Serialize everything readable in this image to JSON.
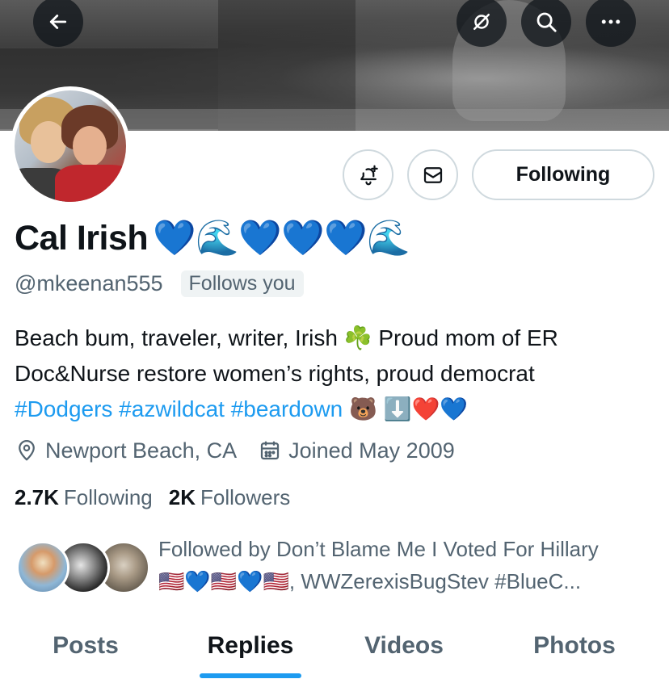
{
  "profile": {
    "display_name": "Cal Irish",
    "name_emojis": "💙🌊💙💙💙🌊",
    "handle": "@mkeenan555",
    "follows_you": "Follows you",
    "bio_line1": "Beach bum, traveler, writer, Irish ☘️ Proud mom of ER",
    "bio_line2": "Doc&Nurse restore women’s rights, proud democrat",
    "bio_tags": "#Dodgers #azwildcat #beardown",
    "bio_emojis": "🐻 ⬇️❤️💙",
    "location": "Newport Beach, CA",
    "joined": "Joined May 2009",
    "following_count": "2.7K",
    "following_label": "Following",
    "followers_count": "2K",
    "followers_label": "Followers"
  },
  "actions": {
    "following_label": "Following"
  },
  "followed_by": {
    "line1": "Followed by Don’t Blame Me I Voted For Hillary",
    "line2": "🇺🇸💙🇺🇸💙🇺🇸, WWZerexisBugStev #BlueC..."
  },
  "tabs": [
    {
      "label": "Posts"
    },
    {
      "label": "Replies"
    },
    {
      "label": "Videos"
    },
    {
      "label": "Photos"
    }
  ],
  "icons": {
    "back": "arrow-left-icon",
    "hide": "eye-off-icon",
    "search": "search-icon",
    "more": "more-icon",
    "notify": "bell-plus-icon",
    "message": "envelope-icon",
    "location": "location-pin-icon",
    "calendar": "calendar-icon"
  },
  "colors": {
    "accent": "#1d9bf0",
    "text": "#0f1419",
    "secondary": "#536471"
  }
}
